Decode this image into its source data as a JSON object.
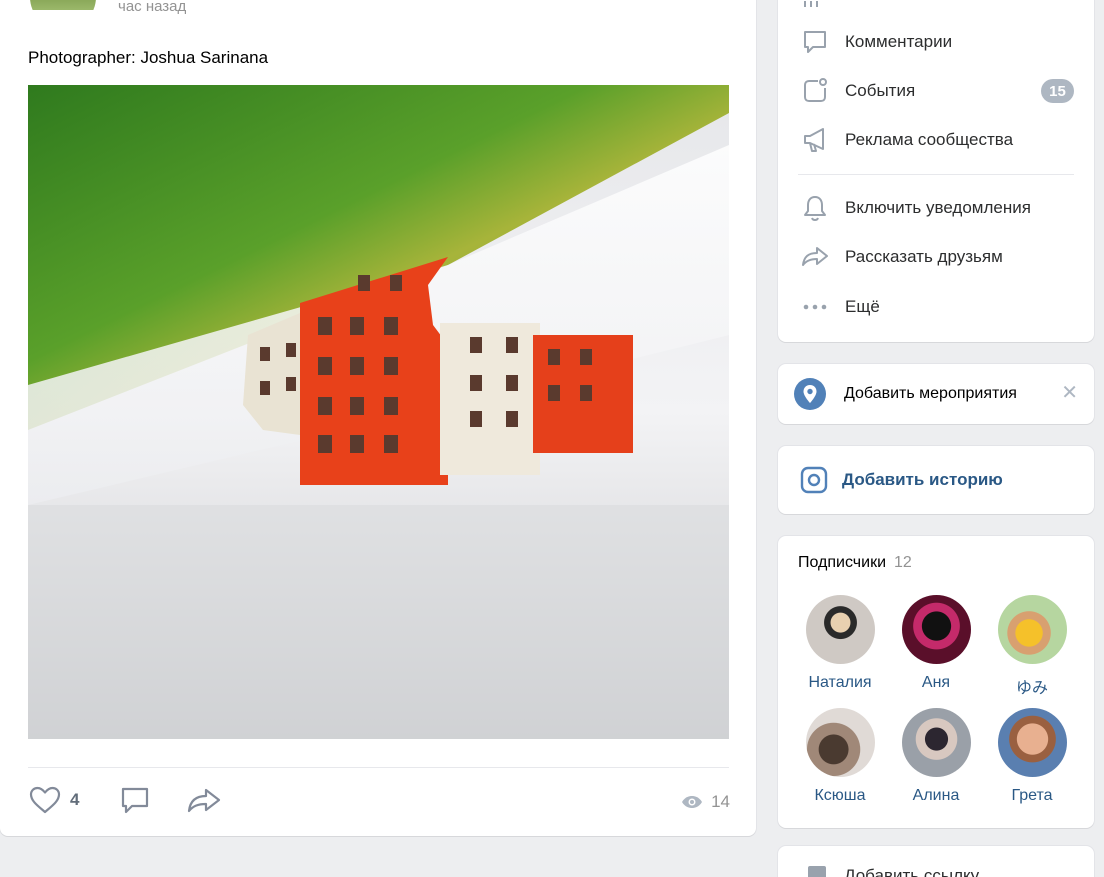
{
  "post": {
    "time": "час назад",
    "text": "Photographer: Joshua Sarinana",
    "likes": "4",
    "views": "14"
  },
  "menu": {
    "items": [
      {
        "label": "Комментарии",
        "icon": "comment-icon"
      },
      {
        "label": "События",
        "icon": "events-icon",
        "badge": "15"
      },
      {
        "label": "Реклама сообщества",
        "icon": "megaphone-icon"
      },
      {
        "label": "Включить уведомления",
        "icon": "bell-icon"
      },
      {
        "label": "Рассказать друзьям",
        "icon": "share-icon"
      },
      {
        "label": "Ещё",
        "icon": "more-icon"
      }
    ]
  },
  "event_card": {
    "label": "Добавить мероприятия"
  },
  "story_card": {
    "label": "Добавить историю"
  },
  "followers": {
    "title": "Подписчики",
    "count": "12",
    "people": [
      {
        "name": "Наталия"
      },
      {
        "name": "Аня"
      },
      {
        "name": "ゆみ"
      },
      {
        "name": "Ксюша"
      },
      {
        "name": "Алина"
      },
      {
        "name": "Грета"
      }
    ]
  },
  "bottom_card": {
    "label": "Добавить ссылку"
  },
  "colors": {
    "link": "#2a5885",
    "accent": "#5181b8",
    "muted": "#939393",
    "icon": "#99a2ad"
  }
}
